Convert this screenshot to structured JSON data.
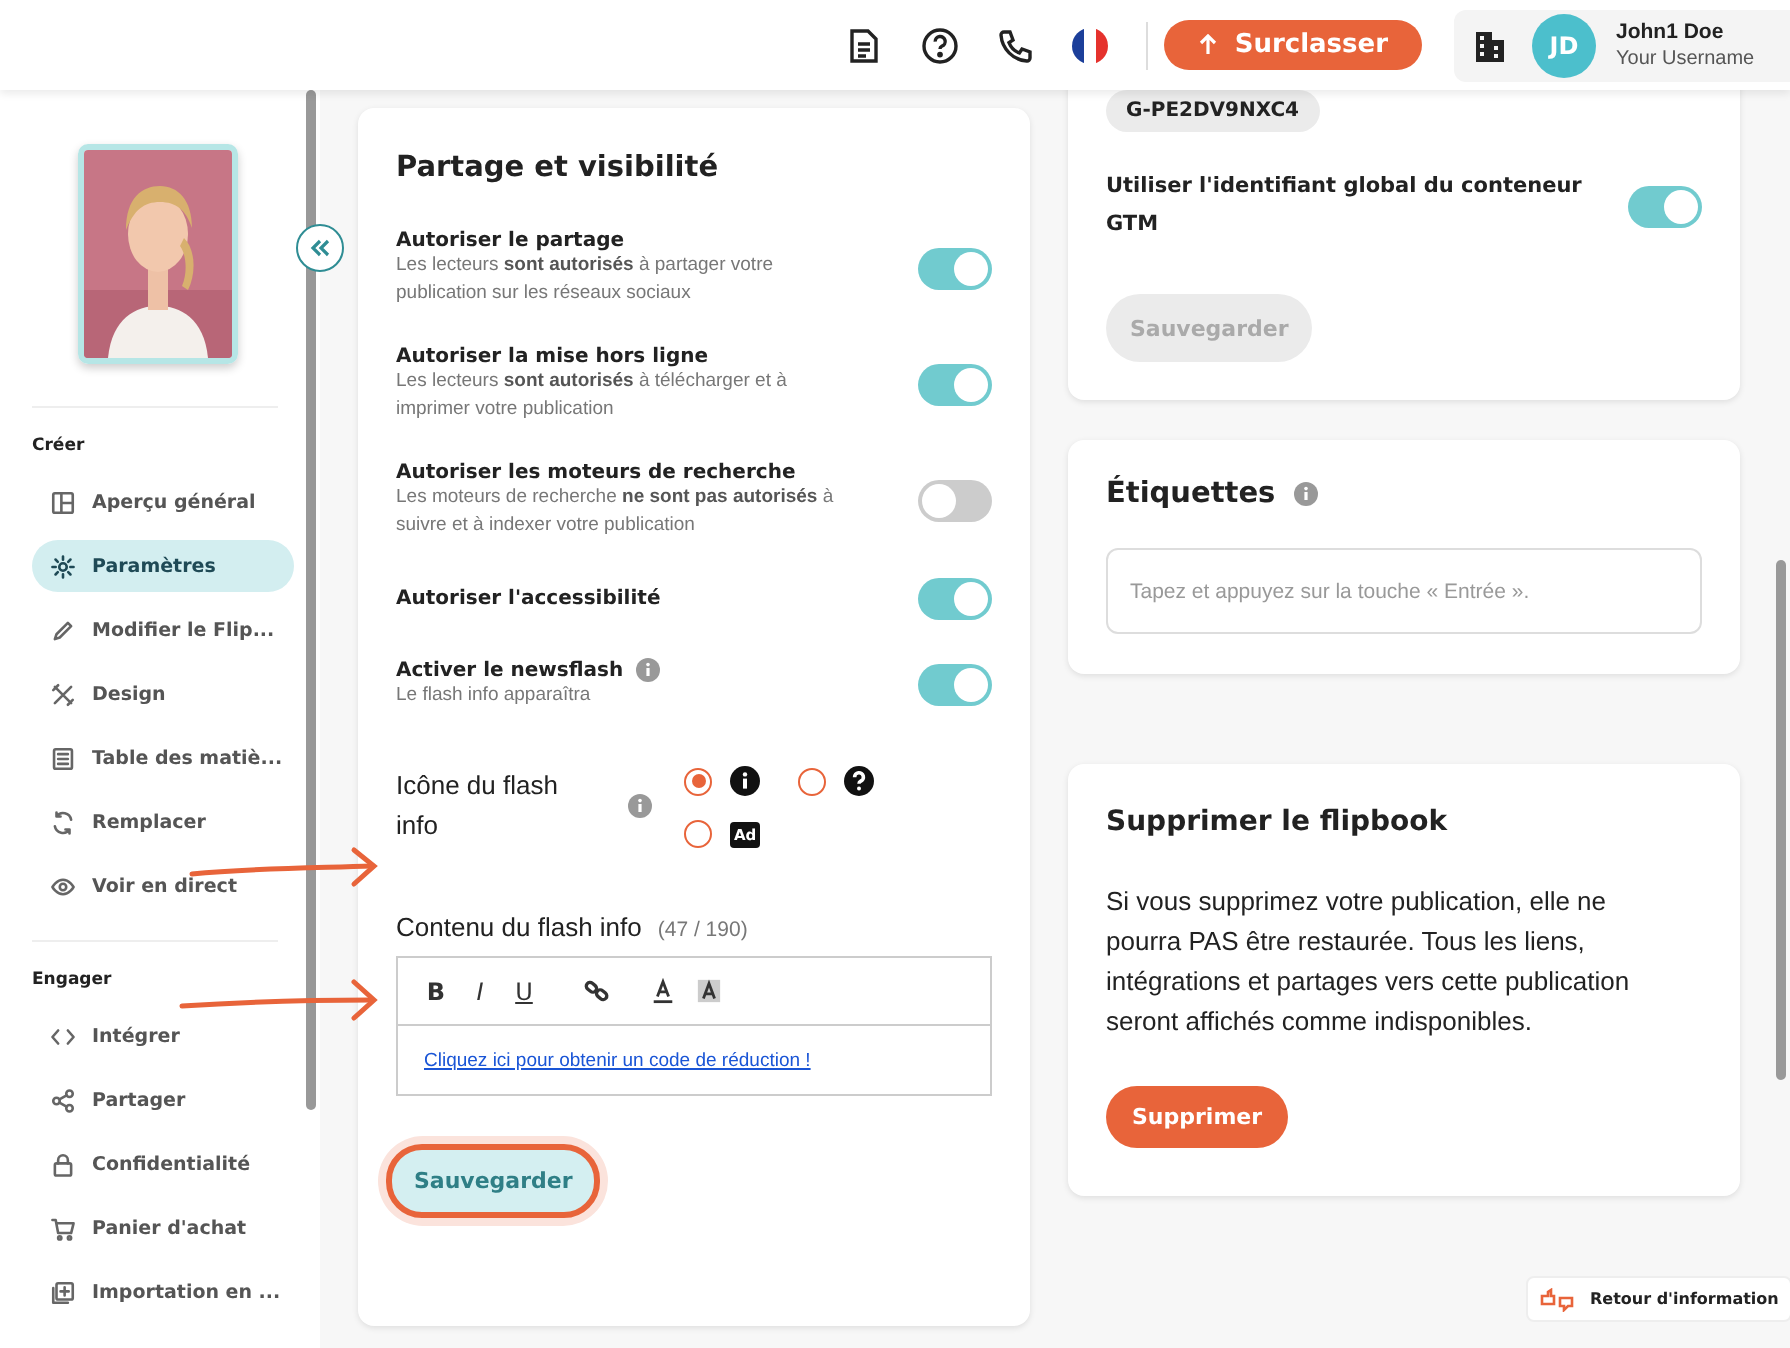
{
  "header": {
    "upgrade_button": "Surclasser",
    "user": {
      "initials": "JD",
      "name": "John1 Doe",
      "username": "Your Username"
    }
  },
  "sidebar": {
    "sections": [
      {
        "title": "Créer",
        "items": [
          {
            "label": "Aperçu général",
            "selected": false
          },
          {
            "label": "Paramètres",
            "selected": true
          },
          {
            "label": "Modifier le Flip...",
            "selected": false
          },
          {
            "label": "Design",
            "selected": false
          },
          {
            "label": "Table des matiè...",
            "selected": false
          },
          {
            "label": "Remplacer",
            "selected": false
          },
          {
            "label": "Voir en direct",
            "selected": false
          }
        ]
      },
      {
        "title": "Engager",
        "items": [
          {
            "label": "Intégrer",
            "selected": false
          },
          {
            "label": "Partager",
            "selected": false
          },
          {
            "label": "Confidentialité",
            "selected": false
          },
          {
            "label": "Panier d'achat",
            "selected": false
          },
          {
            "label": "Importation en ...",
            "selected": false
          }
        ]
      }
    ]
  },
  "sharing_card": {
    "title": "Partage et visibilité",
    "settings": [
      {
        "label": "Autoriser le partage",
        "description": "Les lecteurs **sont autorisés** à partager votre publication sur les réseaux sociaux",
        "on": true,
        "info": false
      },
      {
        "label": "Autoriser la mise hors ligne",
        "description": "Les lecteurs **sont autorisés** à télécharger et à imprimer votre publication",
        "on": true,
        "info": false
      },
      {
        "label": "Autoriser les moteurs de recherche",
        "description": "Les moteurs de recherche **ne sont pas autorisés** à suivre et à indexer votre publication",
        "on": false,
        "info": false
      },
      {
        "label": "Autoriser l'accessibilité",
        "on": true,
        "info": false
      },
      {
        "label": "Activer le newsflash",
        "description": "Le flash info apparaîtra",
        "on": true,
        "info": true
      }
    ],
    "icon_choice": {
      "label": "Icône du flash info",
      "options": [
        {
          "kind": "info",
          "selected": true
        },
        {
          "kind": "question",
          "selected": false
        },
        {
          "kind": "ad",
          "label": "Ad",
          "selected": false
        }
      ]
    },
    "content": {
      "label": "Contenu du flash info",
      "counter": "(47 / 190)",
      "toolbar": [
        "B",
        "I",
        "U"
      ],
      "link": "Cliquez ici pour obtenir un code de réduction !"
    },
    "save_button": {
      "label": "Sauvegarder",
      "highlighted": true
    }
  },
  "gtm_card": {
    "tracking_id": "G-PE2DV9NXC4",
    "setting": {
      "label": "Utiliser l'identifiant global du conteneur GTM",
      "on": true
    },
    "save_button": {
      "label": "Sauvegarder",
      "disabled": true
    }
  },
  "tags_card": {
    "title": "Étiquettes",
    "placeholder": "Tapez et appuyez sur la touche « Entrée »."
  },
  "delete_card": {
    "title": "Supprimer le flipbook",
    "text": "Si vous supprimez votre publication, elle ne pourra PAS être restaurée. Tous les liens, intégrations et partages vers cette publication seront affichés comme indisponibles.",
    "button": "Supprimer"
  },
  "feedback_button": "Retour d'information"
}
